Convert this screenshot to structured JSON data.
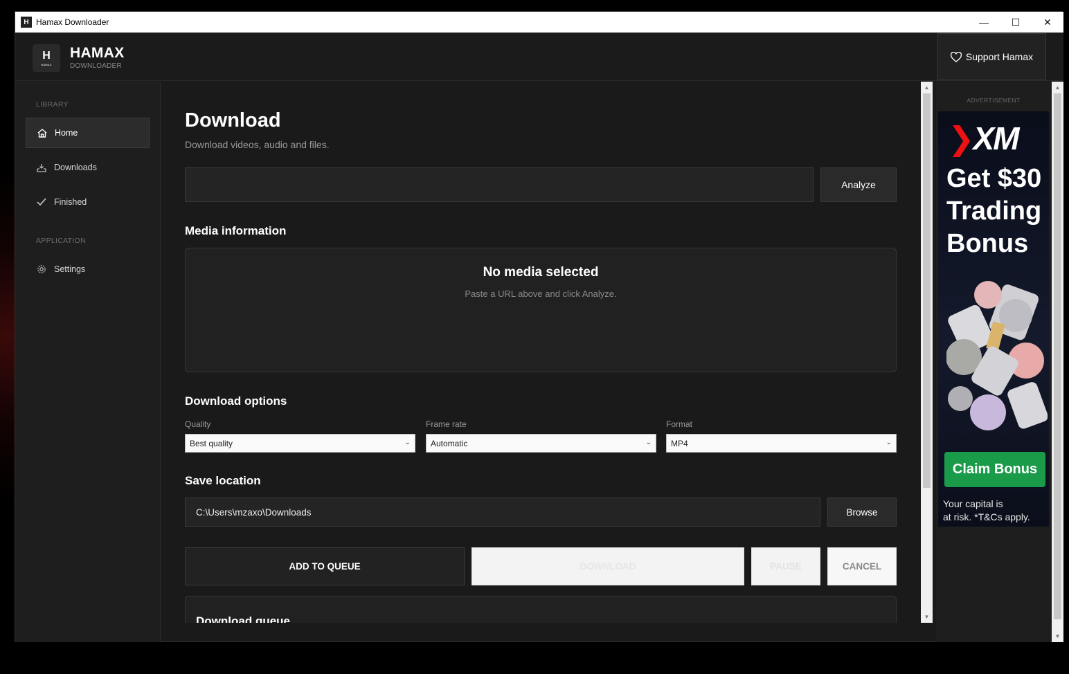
{
  "window": {
    "title": "Hamax Downloader",
    "minimize_icon": "minimize-icon",
    "maximize_icon": "maximize-icon",
    "close_icon": "close-icon"
  },
  "header": {
    "logo_letter": "H",
    "logo_small": "HAMAX",
    "brand_name": "HAMAX",
    "brand_sub": "DOWNLOADER",
    "support_label": "Support Hamax"
  },
  "sidebar": {
    "library_label": "LIBRARY",
    "application_label": "APPLICATION",
    "items": [
      {
        "label": "Home",
        "icon": "home-icon",
        "active": true
      },
      {
        "label": "Downloads",
        "icon": "download-tray-icon",
        "active": false
      },
      {
        "label": "Finished",
        "icon": "checkmark-icon",
        "active": false
      },
      {
        "label": "Settings",
        "icon": "gear-icon",
        "active": false
      }
    ]
  },
  "main": {
    "title": "Download",
    "subtitle": "Download videos, audio and files.",
    "url_value": "",
    "analyze_label": "Analyze",
    "media_heading": "Media information",
    "no_media_title": "No media selected",
    "no_media_hint": "Paste a URL above and click Analyze.",
    "options_heading": "Download options",
    "quality_label": "Quality",
    "quality_value": "Best quality",
    "framerate_label": "Frame rate",
    "framerate_value": "Automatic",
    "format_label": "Format",
    "format_value": "MP4",
    "save_heading": "Save location",
    "save_path": "C:\\Users\\mzaxo\\Downloads",
    "browse_label": "Browse",
    "add_queue_label": "ADD TO QUEUE",
    "download_label": "DOWNLOAD",
    "pause_label": "PAUSE",
    "cancel_label": "CANCEL",
    "queue_heading": "Download queue"
  },
  "ad": {
    "label": "ADVERTISEMENT",
    "brand": "XM",
    "headline_lines": [
      "Get $30",
      "Trading",
      "Bonus"
    ],
    "cta": "Claim Bonus",
    "disclaimer_lines": [
      "Your capital is",
      "at risk. *T&Cs apply."
    ]
  },
  "colors": {
    "background": "#1a1a1a",
    "panel": "#212121",
    "ad_cta": "#1a9b4a",
    "ad_brand_x": "#e11111"
  }
}
